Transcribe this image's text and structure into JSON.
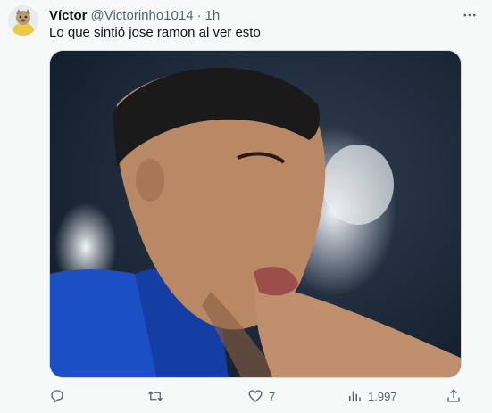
{
  "tweet": {
    "author_name": "Víctor",
    "handle": "@Victorinho1014",
    "separator": "·",
    "time": "1h",
    "text": "Lo que sintió jose ramon al ver esto",
    "icons": {
      "avatar": "profile-avatar",
      "more": "more-icon",
      "reply": "reply-icon",
      "retweet": "retweet-icon",
      "like": "heart-icon",
      "views": "views-icon",
      "share": "share-icon"
    },
    "stats": {
      "likes": "7",
      "views": "1.997"
    }
  },
  "colors": {
    "background": "#f7f9f9",
    "text": "#0f1419",
    "muted": "#536471",
    "border": "#cfd9de"
  }
}
